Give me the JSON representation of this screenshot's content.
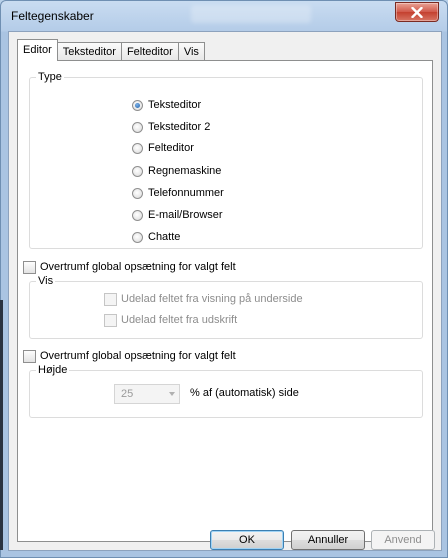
{
  "window": {
    "title": "Feltegenskaber"
  },
  "tabs": [
    {
      "label": "Editor",
      "active": true
    },
    {
      "label": "Teksteditor",
      "active": false
    },
    {
      "label": "Felteditor",
      "active": false
    },
    {
      "label": "Vis",
      "active": false
    }
  ],
  "type_group": {
    "label": "Type",
    "options": [
      {
        "label": "Teksteditor",
        "checked": true
      },
      {
        "label": "Teksteditor 2",
        "checked": false
      },
      {
        "label": "Felteditor",
        "checked": false
      },
      {
        "label": "Regnemaskine",
        "checked": false
      },
      {
        "label": "Telefonnummer",
        "checked": false
      },
      {
        "label": "E-mail/Browser",
        "checked": false
      },
      {
        "label": "Chatte",
        "checked": false
      }
    ]
  },
  "override1": {
    "label": "Overtrumf global opsætning for valgt felt",
    "checked": false
  },
  "vis_group": {
    "label": "Vis",
    "options": [
      {
        "label": "Udelad feltet fra visning på underside",
        "checked": false,
        "enabled": false
      },
      {
        "label": "Udelad feltet fra udskrift",
        "checked": false,
        "enabled": false
      }
    ]
  },
  "override2": {
    "label": "Overtrumf global opsætning for valgt felt",
    "checked": false
  },
  "height_group": {
    "label": "Højde",
    "value": "25",
    "unit": "% af (automatisk) side",
    "enabled": false
  },
  "buttons": {
    "ok": "OK",
    "cancel": "Annuller",
    "apply": "Anvend",
    "apply_enabled": false
  }
}
